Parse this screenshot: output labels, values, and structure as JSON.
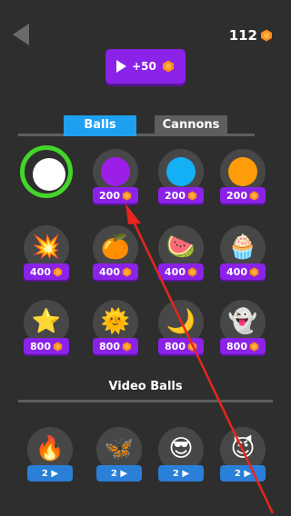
{
  "header": {
    "back_icon": "back-arrow-icon",
    "coins": "112",
    "video_reward": "+50"
  },
  "tabs": [
    {
      "label": "Balls",
      "active": true
    },
    {
      "label": "Cannons",
      "active": false
    }
  ],
  "balls": [
    {
      "type": "color",
      "color": "#ffffff",
      "selected": true
    },
    {
      "type": "color",
      "color": "#9c1fe8",
      "price": "200"
    },
    {
      "type": "color",
      "color": "#13b0f5",
      "price": "200"
    },
    {
      "type": "color",
      "color": "#ff9c0a",
      "price": "200"
    },
    {
      "type": "emoji",
      "emoji": "💥",
      "price": "400"
    },
    {
      "type": "emoji",
      "emoji": "🍊",
      "price": "400"
    },
    {
      "type": "emoji",
      "emoji": "🍉",
      "price": "400"
    },
    {
      "type": "emoji",
      "emoji": "🧁",
      "price": "400"
    },
    {
      "type": "emoji",
      "emoji": "⭐",
      "price": "800"
    },
    {
      "type": "emoji",
      "emoji": "🌞",
      "price": "800"
    },
    {
      "type": "emoji",
      "emoji": "🌙",
      "price": "800"
    },
    {
      "type": "emoji",
      "emoji": "👻",
      "price": "800"
    }
  ],
  "video_section": {
    "title": "Video Balls",
    "items": [
      {
        "emoji": "🔥",
        "price": "2 ▶"
      },
      {
        "emoji": "🦋",
        "price": "2 ▶"
      },
      {
        "emoji": "😎",
        "price": "2 ▶"
      },
      {
        "emoji": "😈",
        "price": "2 ▶"
      }
    ]
  },
  "colors": {
    "background": "#2e2e2e",
    "accent_purple": "#8a22e8",
    "tab_active": "#1ea0f0",
    "selected_ring": "#42d62a",
    "coin": "#ff8c1a",
    "annotation_arrow": "#e8251f"
  }
}
